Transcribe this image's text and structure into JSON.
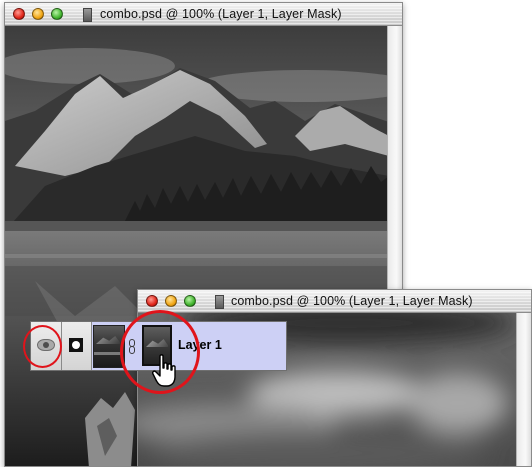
{
  "back_window": {
    "title": "combo.psd @ 100% (Layer 1, Layer Mask)"
  },
  "front_window": {
    "title": "combo.psd @ 100% (Layer 1, Layer Mask)"
  },
  "layers_row": {
    "layer_name": "Layer 1",
    "visibility_icon": "eye-icon",
    "mask_mode_icon": "circle-mask-icon",
    "link_icon": "chain-link-icon",
    "cursor_icon": "hand-pointer-icon"
  },
  "colors": {
    "selected_row": "#cdd0f5",
    "highlight_circle": "#e0141b"
  }
}
